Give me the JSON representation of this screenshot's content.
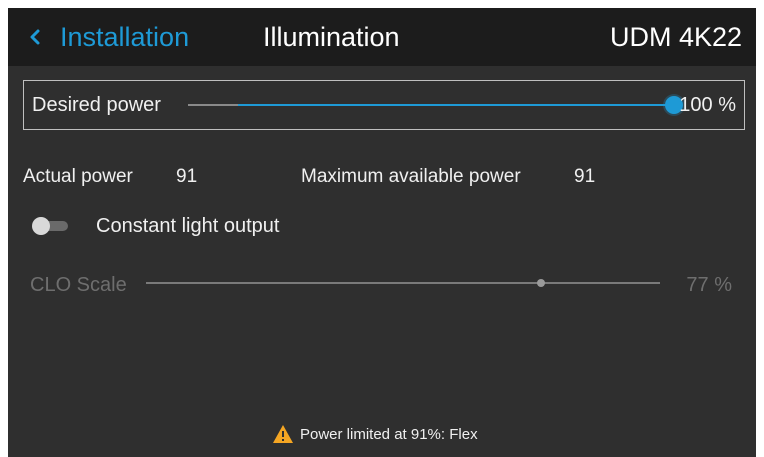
{
  "header": {
    "back_label": "Installation",
    "title": "Illumination",
    "device": "UDM 4K22"
  },
  "desired_power": {
    "label": "Desired power",
    "value_text": "100 %",
    "value": 100
  },
  "stats": {
    "actual_power_label": "Actual power",
    "actual_power_value": "91",
    "max_power_label": "Maximum available power",
    "max_power_value": "91"
  },
  "clo": {
    "toggle_label": "Constant light output",
    "toggle_on": false,
    "scale_label": "CLO Scale",
    "scale_value_text": "77 %",
    "scale_value": 77
  },
  "warning": {
    "text": "Power limited at 91%: Flex",
    "icon": "warning-icon"
  },
  "colors": {
    "accent": "#1e9ad6",
    "background": "#2f2f2f",
    "header": "#1c1c1c",
    "warning": "#f5a623"
  }
}
